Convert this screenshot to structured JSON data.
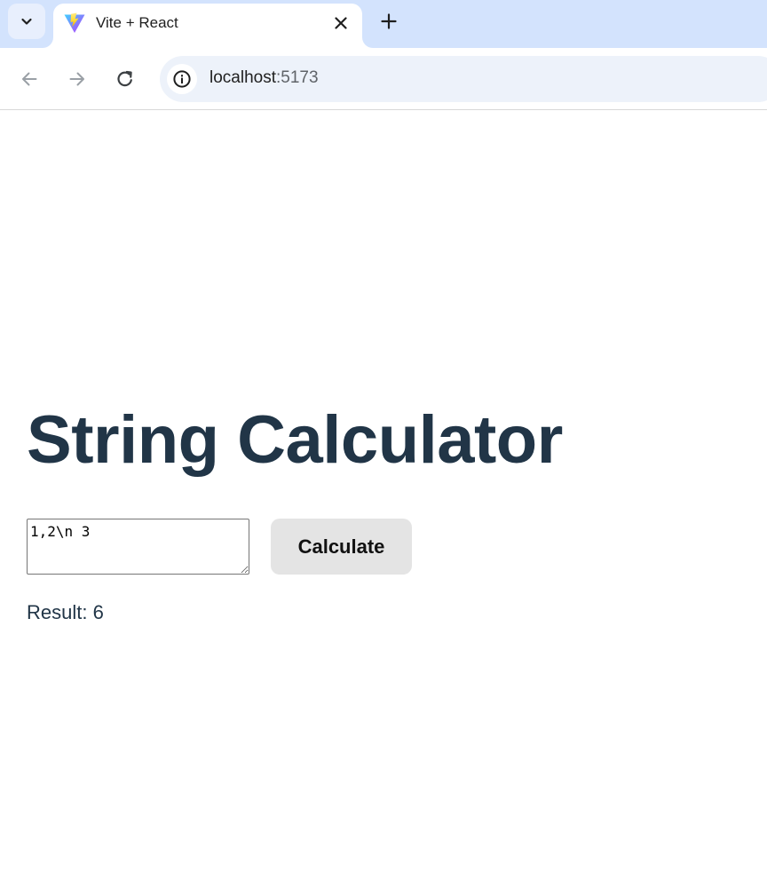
{
  "browser": {
    "tab": {
      "title": "Vite + React",
      "favicon": "vite-logo-icon"
    },
    "address_bar": {
      "host": "localhost",
      "port": ":5173"
    },
    "icons": {
      "tab_search": "chevron-down-icon",
      "close": "close-icon",
      "new_tab": "plus-icon",
      "back": "arrow-left-icon",
      "forward": "arrow-right-icon",
      "reload": "reload-icon",
      "site_info": "info-icon"
    },
    "colors": {
      "tabstrip": "#d3e3fd",
      "omnibox": "#edf2fa"
    }
  },
  "app": {
    "title": "String Calculator",
    "input_value": "1,2\\n 3",
    "button_label": "Calculate",
    "result_text": "Result: 6",
    "colors": {
      "heading": "#213547",
      "button_bg": "#e4e4e4"
    }
  }
}
